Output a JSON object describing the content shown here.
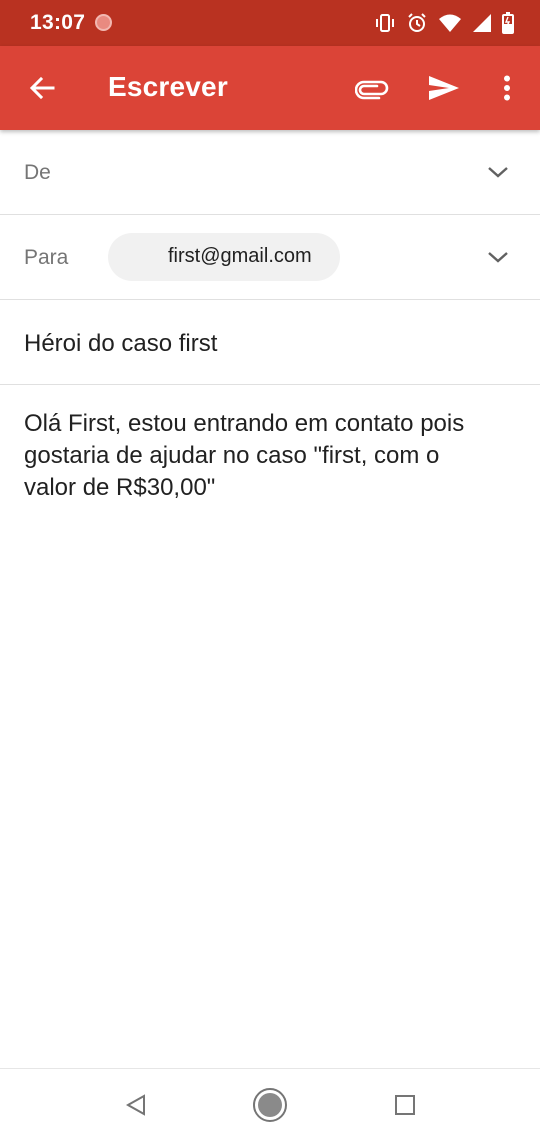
{
  "status_bar": {
    "time": "13:07",
    "icons": [
      "recording-dot-icon",
      "vibrate-icon",
      "alarm-icon",
      "wifi-icon",
      "signal-icon",
      "battery-icon"
    ]
  },
  "app_bar": {
    "title": "Escrever",
    "color": "#db4437",
    "status_color": "#b93221",
    "icons": [
      "back-arrow-icon",
      "attach-icon",
      "send-icon",
      "more-vert-icon"
    ]
  },
  "compose": {
    "from_label": "De",
    "to_label": "Para",
    "to_chip": "first@gmail.com",
    "subject": "Héroi do caso first",
    "body": "Olá First, estou entrando em contato pois gostaria de ajudar no caso \"first, com o valor de R$30,00\""
  },
  "nav_bar": {
    "icons": [
      "nav-back-icon",
      "nav-home-icon",
      "nav-recents-icon"
    ]
  }
}
